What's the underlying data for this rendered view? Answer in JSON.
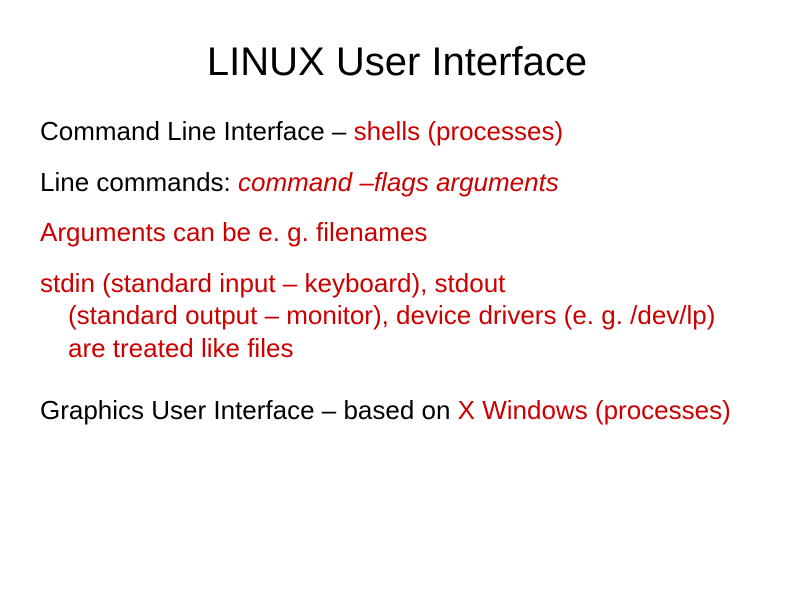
{
  "title": "LINUX User Interface",
  "line1": {
    "a": "Command Line Interface – ",
    "b": "shells (processes)"
  },
  "line2": {
    "a": "Line commands: ",
    "b": "command –flags arguments"
  },
  "line3": "Arguments can be e. g. filenames",
  "line4": {
    "a": "stdin (standard input – keyboard), stdout",
    "b": "(standard output – monitor), device drivers (e. g. /dev/lp) are treated like files"
  },
  "line5": {
    "a": "Graphics User Interface – based on ",
    "b": "X Windows (processes)"
  }
}
